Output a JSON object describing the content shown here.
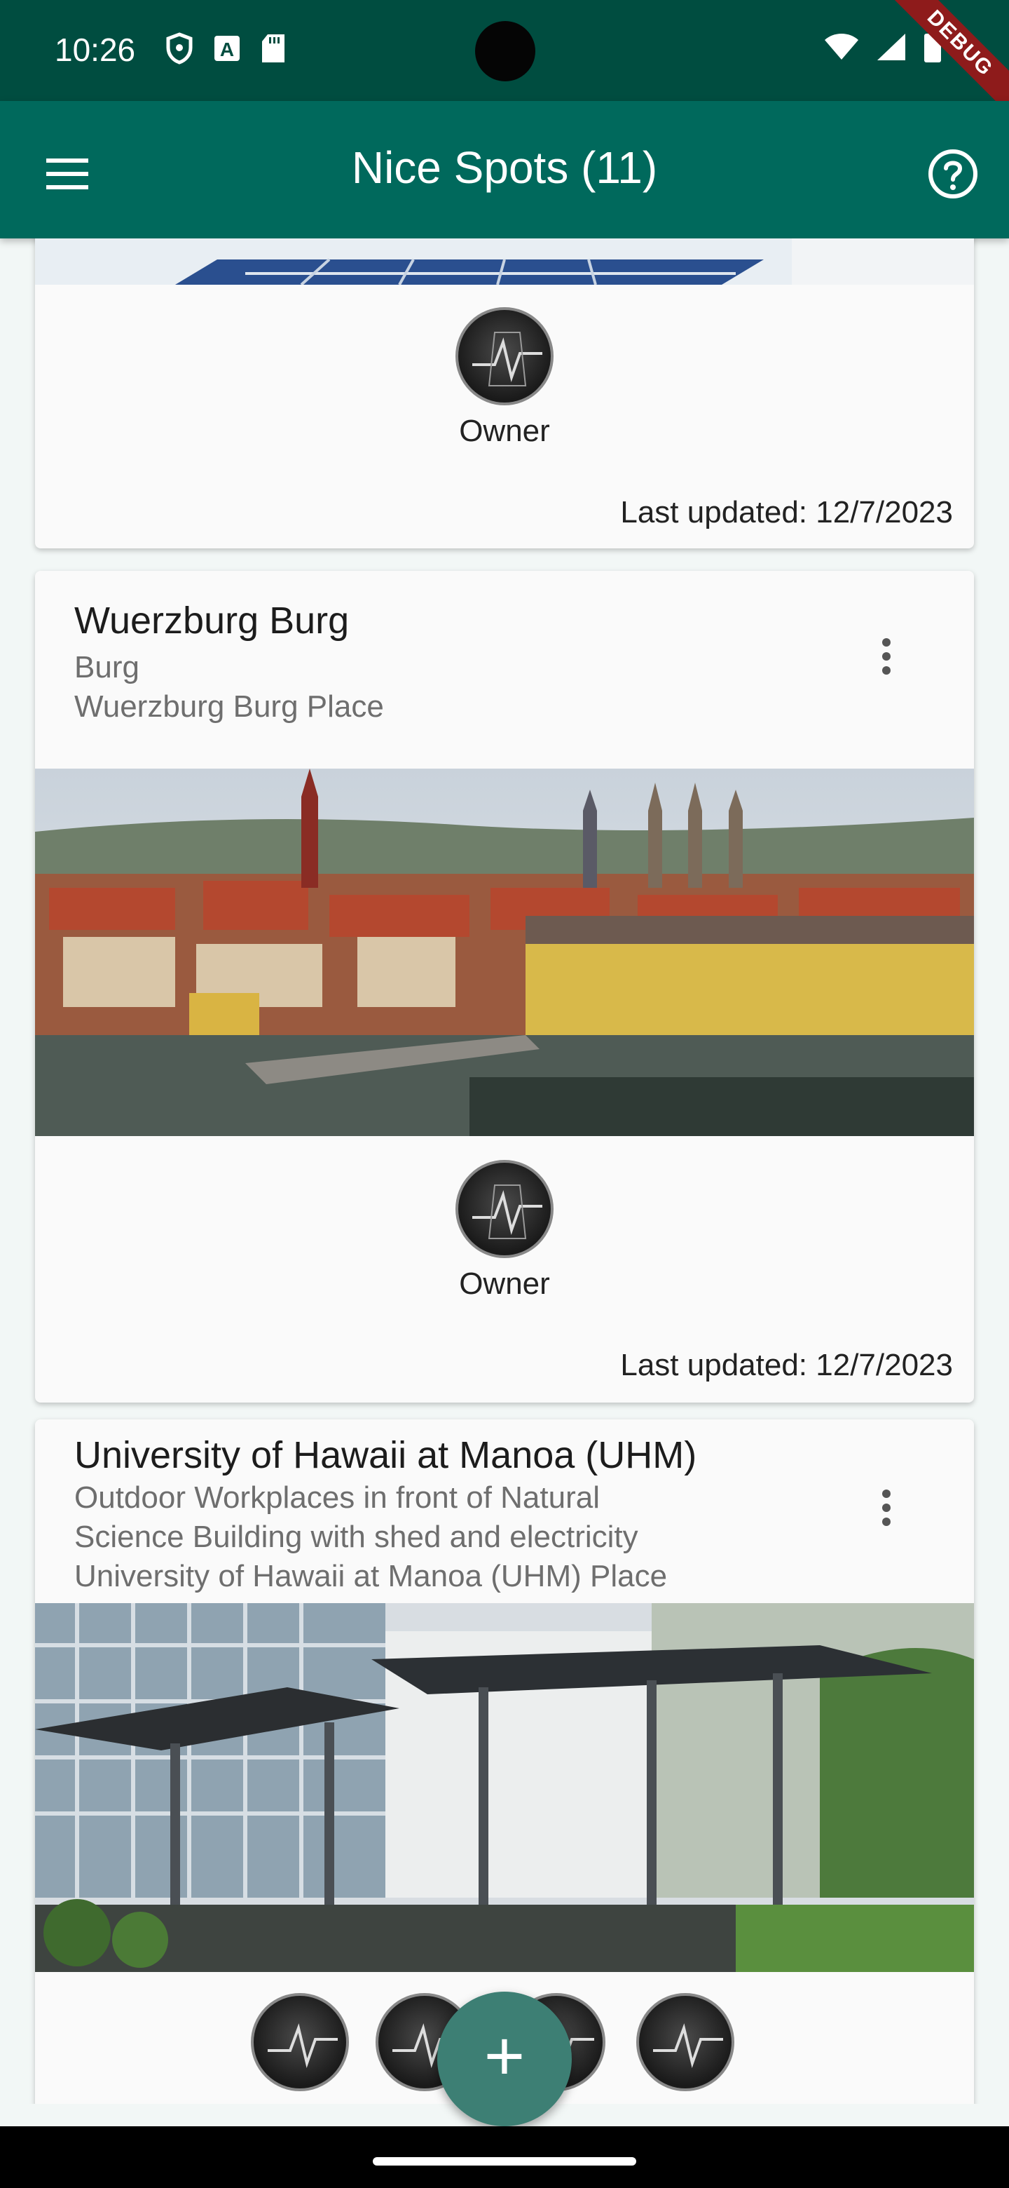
{
  "status_bar": {
    "time": "10:26",
    "left_icons": [
      "shield-icon",
      "a-badge-icon",
      "sd-card-icon"
    ],
    "right_icons": [
      "wifi-icon",
      "signal-icon",
      "battery-icon"
    ],
    "debug_banner": "DEBUG"
  },
  "app_bar": {
    "title": "Nice Spots (11)",
    "menu_icon": "menu-icon",
    "help_icon": "help-circle-icon"
  },
  "cards": [
    {
      "owner_label": "Owner",
      "last_updated": "Last updated: 12/7/2023"
    },
    {
      "title": "Wuerzburg Burg",
      "subtitle_lines": [
        "Burg",
        "Wuerzburg Burg Place"
      ],
      "owner_label": "Owner",
      "last_updated": "Last updated: 12/7/2023"
    },
    {
      "title": "University of Hawaii at Manoa (UHM)",
      "subtitle_lines": [
        "Outdoor Workplaces in front of Natural",
        "Science Building with shed and electricity",
        "University of Hawaii at Manoa (UHM) Place"
      ]
    }
  ],
  "fab": {
    "icon": "plus-icon",
    "label": "+"
  },
  "colors": {
    "status_bar": "#004d40",
    "app_bar": "#00695c",
    "fab": "#3d7f74",
    "background": "#f2f7f6"
  }
}
